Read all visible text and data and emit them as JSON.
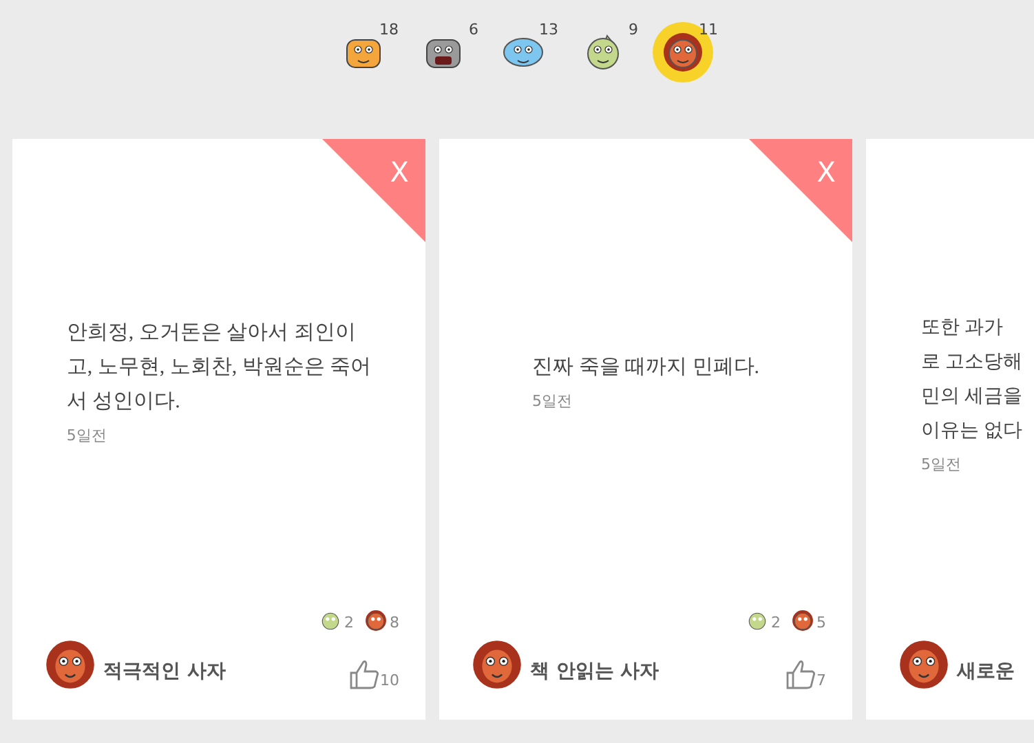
{
  "filters": [
    {
      "kind": "tiger",
      "count": "18",
      "selected": false
    },
    {
      "kind": "hippo",
      "count": "6",
      "selected": false
    },
    {
      "kind": "elephant",
      "count": "13",
      "selected": false
    },
    {
      "kind": "dino",
      "count": "9",
      "selected": false
    },
    {
      "kind": "lion",
      "count": "11",
      "selected": true
    }
  ],
  "cards": [
    {
      "close": "X",
      "lines": [
        "안희정, 오거돈은 살아서 죄인이",
        "고, 노무현, 노회찬, 박원순은 죽어",
        "서 성인이다."
      ],
      "time": "5일전",
      "reactions": [
        {
          "kind": "dino",
          "count": "2"
        },
        {
          "kind": "lion",
          "count": "8"
        }
      ],
      "likes": "10",
      "author": {
        "kind": "lion",
        "name": "적극적인 사자"
      }
    },
    {
      "close": "X",
      "lines": [
        "진짜 죽을 때까지 민폐다."
      ],
      "time": "5일전",
      "reactions": [
        {
          "kind": "dino",
          "count": "2"
        },
        {
          "kind": "lion",
          "count": "5"
        }
      ],
      "likes": "7",
      "author": {
        "kind": "lion",
        "name": "책 안읽는 사자"
      }
    },
    {
      "lines": [
        "또한 과가",
        "로 고소당해",
        "민의 세금을",
        "이유는 없다"
      ],
      "time": "5일전",
      "author": {
        "kind": "lion",
        "name": "새로운"
      }
    }
  ]
}
